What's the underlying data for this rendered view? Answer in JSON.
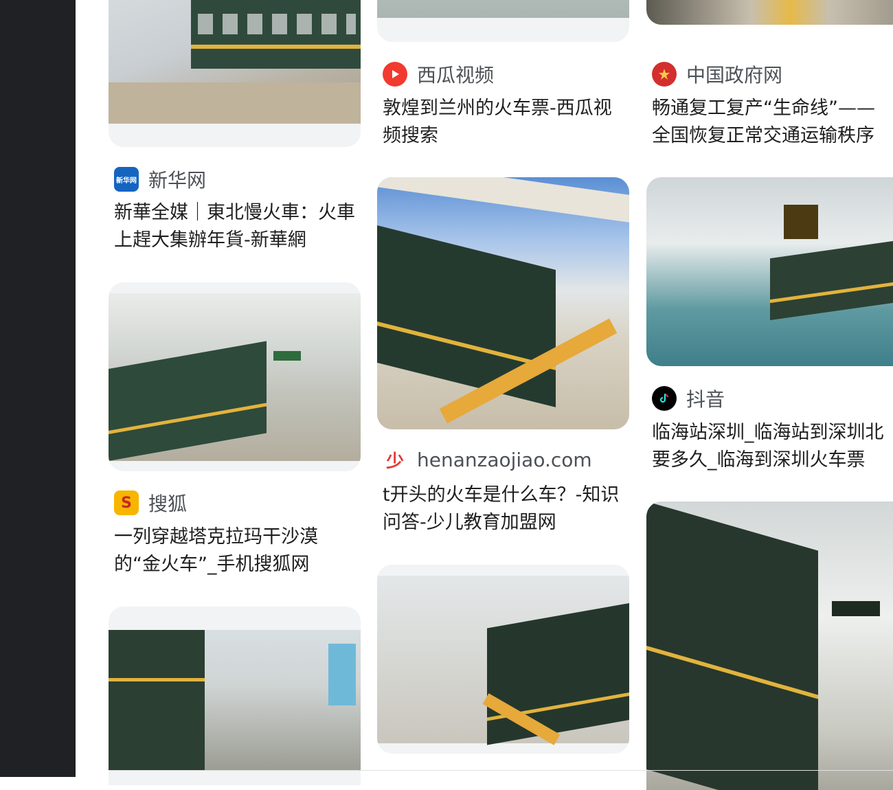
{
  "results": [
    {
      "source": "新华网",
      "title": "新華全媒｜東北慢火車：火車上趕大集辦年貨-新華網",
      "icon": "xinhua-logo",
      "color": "#1565c0"
    },
    {
      "source": "西瓜视频",
      "title": "敦煌到兰州的火车票-西瓜视频搜索",
      "icon": "xigua-play-icon",
      "color": "#f23a2f"
    },
    {
      "source": "中国政府网",
      "title": "畅通复工复产“生命线”——全国恢复正常交通运输秩序",
      "icon": "national-emblem-icon",
      "color": "#d32f2f"
    },
    {
      "source": "搜狐",
      "title": "一列穿越塔克拉玛干沙漠的“金火车”_手机搜狐网",
      "icon": "sohu-logo",
      "color": "#f7b500"
    },
    {
      "source": "henanzaojiao.com",
      "title": "t开头的火车是什么车？-知识问答-少儿教育加盟网",
      "icon": "shao-logo",
      "color": "#e53935"
    },
    {
      "source": "抖音",
      "title": "临海站深圳_临海站到深圳北要多久_临海到深圳火车票",
      "icon": "douyin-logo",
      "color": "#000000"
    }
  ],
  "colors": {
    "sidebar": "#202124",
    "train_green": "#2f4a3c",
    "stripe_yellow": "#e2b33d"
  }
}
